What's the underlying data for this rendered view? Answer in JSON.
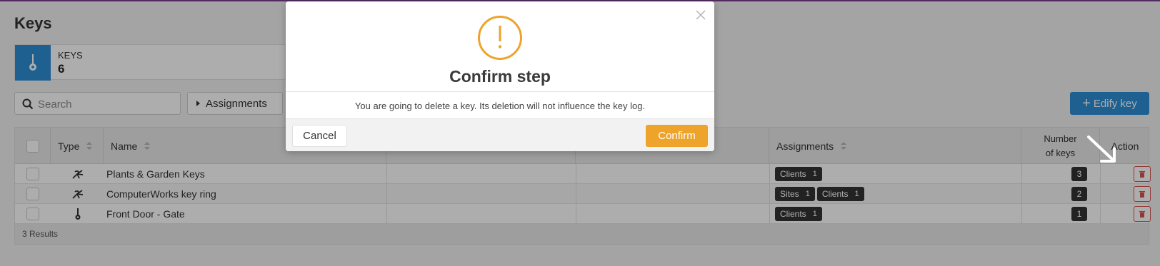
{
  "page": {
    "title": "Keys"
  },
  "summary": {
    "label": "KEYS",
    "value": "6"
  },
  "toolbar": {
    "search_placeholder": "Search",
    "assignments_label": "Assignments",
    "edit_key_label": "Edify key"
  },
  "table": {
    "headers": {
      "type": "Type",
      "name": "Name",
      "assignments": "Assignments",
      "number_of_keys_line1": "Number",
      "number_of_keys_line2": "of keys",
      "action": "Action"
    },
    "rows": [
      {
        "type_icon": "key-ring-icon",
        "name": "Plants & Garden Keys",
        "assignments": [
          {
            "label": "Clients",
            "count": "1"
          }
        ],
        "number_of_keys": "3"
      },
      {
        "type_icon": "key-ring-icon",
        "name": "ComputerWorks key ring",
        "assignments": [
          {
            "label": "Sites",
            "count": "1"
          },
          {
            "label": "Clients",
            "count": "1"
          }
        ],
        "number_of_keys": "2"
      },
      {
        "type_icon": "single-key-icon",
        "name": "Front Door - Gate",
        "assignments": [
          {
            "label": "Clients",
            "count": "1"
          }
        ],
        "number_of_keys": "1"
      }
    ],
    "footer": "3 Results"
  },
  "modal": {
    "title": "Confirm step",
    "message": "You are going to delete a key. Its deletion will not influence the key log.",
    "cancel_label": "Cancel",
    "confirm_label": "Confirm"
  },
  "colors": {
    "primary": "#2d8fd5",
    "confirm": "#eea32b",
    "danger": "#d9534f",
    "tag": "#333333"
  }
}
